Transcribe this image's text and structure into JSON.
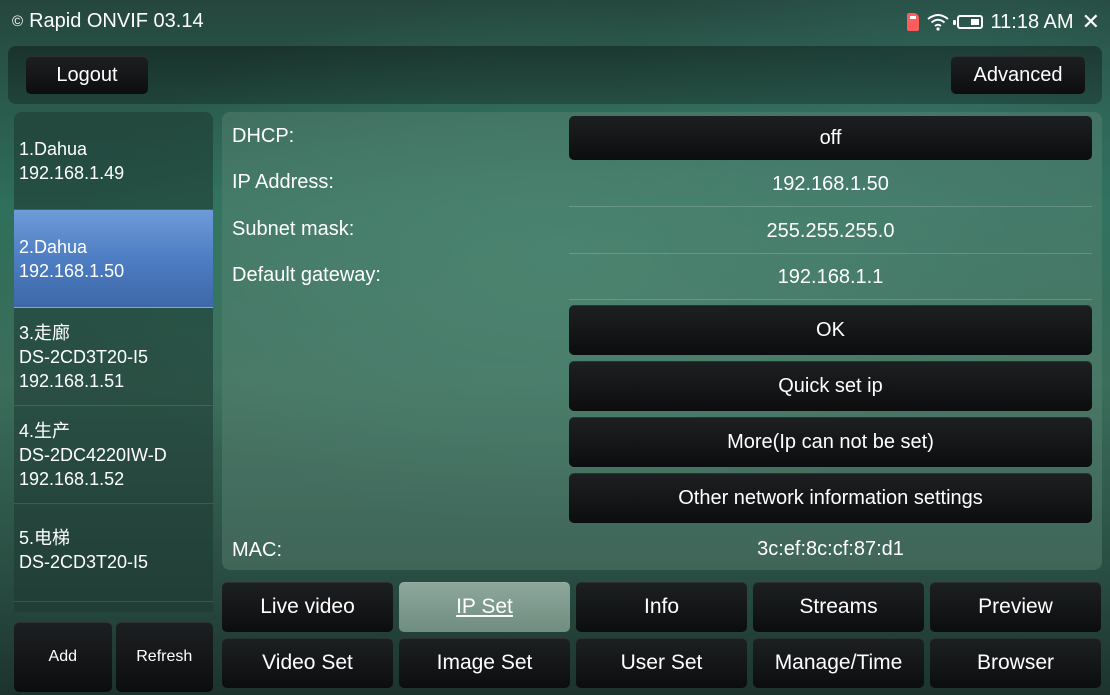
{
  "app": {
    "title": "Rapid ONVIF 03.14",
    "copyright_glyph": "©",
    "time": "11:18 AM"
  },
  "icons": {
    "sd": "sd-card-icon",
    "wifi": "wifi-icon",
    "battery": "battery-icon",
    "close": "close-icon"
  },
  "toolbar": {
    "logout_label": "Logout",
    "advanced_label": "Advanced"
  },
  "devices": [
    {
      "name": "1.Dahua",
      "model": "",
      "ip": "192.168.1.49",
      "selected": false
    },
    {
      "name": "2.Dahua",
      "model": "",
      "ip": "192.168.1.50",
      "selected": true
    },
    {
      "name": "3.走廊",
      "model": "DS-2CD3T20-I5",
      "ip": "192.168.1.51",
      "selected": false
    },
    {
      "name": "4.生产",
      "model": "DS-2DC4220IW-D",
      "ip": "192.168.1.52",
      "selected": false
    },
    {
      "name": "5.电梯",
      "model": "DS-2CD3T20-I5",
      "ip": "",
      "selected": false
    }
  ],
  "list_buttons": {
    "add_label": "Add",
    "refresh_label": "Refresh"
  },
  "ip_settings": {
    "dhcp_label": "DHCP:",
    "dhcp_value": "off",
    "ip_label": "IP Address:",
    "ip_value": "192.168.1.50",
    "subnet_label": "Subnet mask:",
    "subnet_value": "255.255.255.0",
    "gateway_label": "Default gateway:",
    "gateway_value": "192.168.1.1",
    "ok_label": "OK",
    "quick_set_label": "Quick set ip",
    "more_label": "More(Ip can not be set)",
    "other_label": "Other network information settings",
    "mac_label": "MAC:",
    "mac_value": "3c:ef:8c:cf:87:d1"
  },
  "tabs": [
    {
      "label": "Live video",
      "active": false
    },
    {
      "label": "IP Set",
      "active": true
    },
    {
      "label": "Info",
      "active": false
    },
    {
      "label": "Streams",
      "active": false
    },
    {
      "label": "Preview",
      "active": false
    },
    {
      "label": "Video Set",
      "active": false
    },
    {
      "label": "Image Set",
      "active": false
    },
    {
      "label": "User Set",
      "active": false
    },
    {
      "label": "Manage/Time",
      "active": false
    },
    {
      "label": "Browser",
      "active": false
    }
  ]
}
